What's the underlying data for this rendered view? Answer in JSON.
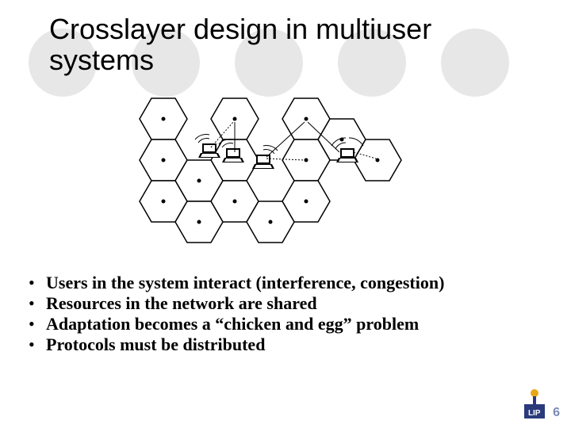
{
  "title": "Crosslayer design in multiuser systems",
  "bullets": [
    "Users in the system interact (interference, congestion)",
    "Resources in the network are shared",
    "Adaptation becomes a “chicken and egg” problem",
    "Protocols must be distributed"
  ],
  "logo": {
    "text_top": "L",
    "text_bottom": "IP"
  },
  "page_number": "6",
  "diagram": {
    "description": "Hexagonal cellular grid with base-station dots and several laptop users emitting radio waves",
    "hex_count": 14,
    "laptops": 4
  }
}
